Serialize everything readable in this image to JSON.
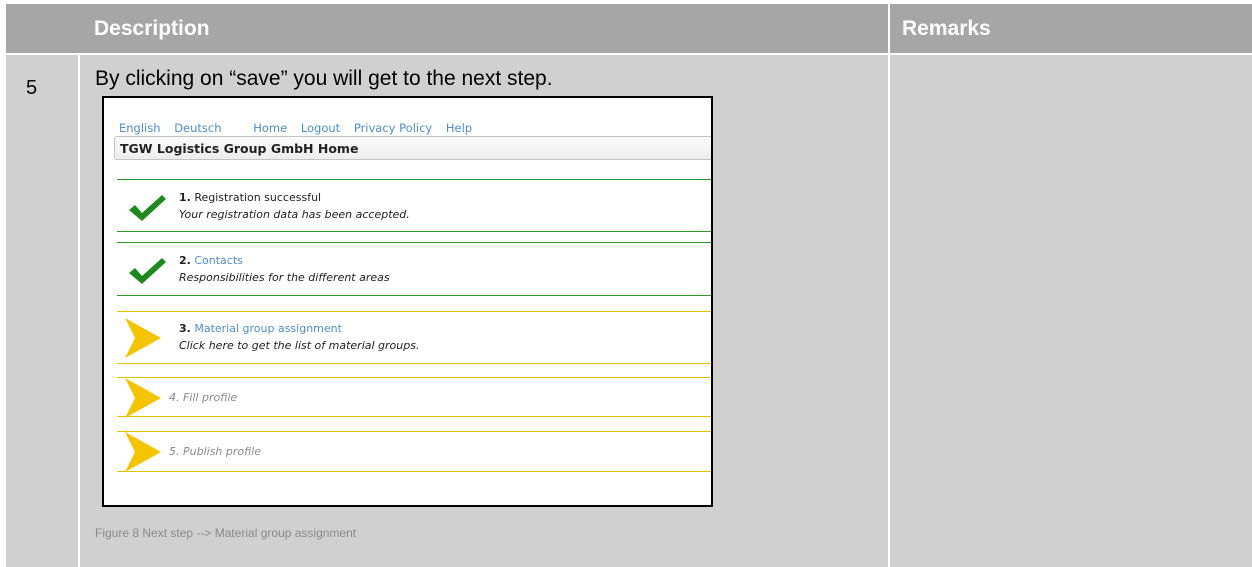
{
  "header": {
    "description": "Description",
    "remarks": "Remarks"
  },
  "row": {
    "number": "5",
    "text": "By clicking on “save” you will get to the next step.",
    "caption": "Figure 8 Next step --> Material group assignment"
  },
  "screenshot": {
    "nav": [
      "English",
      "Deutsch",
      "Home",
      "Logout",
      "Privacy Policy",
      "Help"
    ],
    "title": "TGW Logistics Group GmbH Home",
    "steps": [
      {
        "num": "1.",
        "label": "Registration successful",
        "sub": "Your registration data has been accepted.",
        "status": "done",
        "link": false
      },
      {
        "num": "2.",
        "label": "Contacts",
        "sub": "Responsibilities for the different areas",
        "status": "done",
        "link": true
      },
      {
        "num": "3.",
        "label": "Material group assignment",
        "sub": "Click here to get the list of material groups.",
        "status": "current",
        "link": true
      },
      {
        "label": "4. Fill profile",
        "status": "pending"
      },
      {
        "label": "5. Publish profile",
        "status": "pending"
      }
    ]
  },
  "colors": {
    "header_bg": "#a6a6a6",
    "row_bg": "#d0d0ce",
    "link": "#4f8ec9",
    "check": "#1e8a1e",
    "arrow": "#f5c400"
  }
}
